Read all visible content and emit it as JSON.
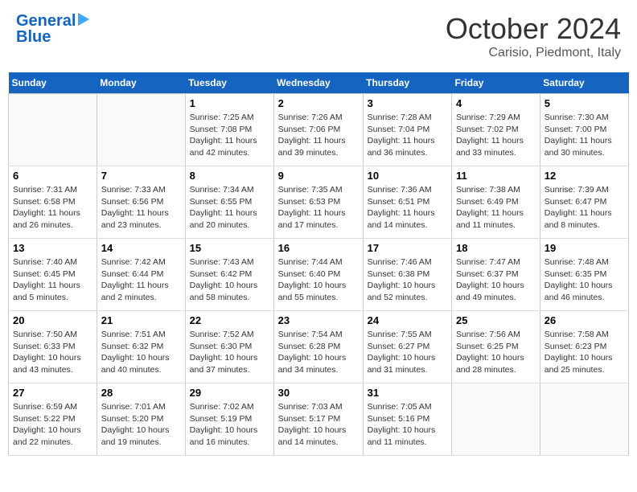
{
  "header": {
    "logo_line1": "General",
    "logo_line2": "Blue",
    "month": "October 2024",
    "location": "Carisio, Piedmont, Italy"
  },
  "days_of_week": [
    "Sunday",
    "Monday",
    "Tuesday",
    "Wednesday",
    "Thursday",
    "Friday",
    "Saturday"
  ],
  "weeks": [
    [
      {
        "num": "",
        "info": ""
      },
      {
        "num": "",
        "info": ""
      },
      {
        "num": "1",
        "info": "Sunrise: 7:25 AM\nSunset: 7:08 PM\nDaylight: 11 hours and 42 minutes."
      },
      {
        "num": "2",
        "info": "Sunrise: 7:26 AM\nSunset: 7:06 PM\nDaylight: 11 hours and 39 minutes."
      },
      {
        "num": "3",
        "info": "Sunrise: 7:28 AM\nSunset: 7:04 PM\nDaylight: 11 hours and 36 minutes."
      },
      {
        "num": "4",
        "info": "Sunrise: 7:29 AM\nSunset: 7:02 PM\nDaylight: 11 hours and 33 minutes."
      },
      {
        "num": "5",
        "info": "Sunrise: 7:30 AM\nSunset: 7:00 PM\nDaylight: 11 hours and 30 minutes."
      }
    ],
    [
      {
        "num": "6",
        "info": "Sunrise: 7:31 AM\nSunset: 6:58 PM\nDaylight: 11 hours and 26 minutes."
      },
      {
        "num": "7",
        "info": "Sunrise: 7:33 AM\nSunset: 6:56 PM\nDaylight: 11 hours and 23 minutes."
      },
      {
        "num": "8",
        "info": "Sunrise: 7:34 AM\nSunset: 6:55 PM\nDaylight: 11 hours and 20 minutes."
      },
      {
        "num": "9",
        "info": "Sunrise: 7:35 AM\nSunset: 6:53 PM\nDaylight: 11 hours and 17 minutes."
      },
      {
        "num": "10",
        "info": "Sunrise: 7:36 AM\nSunset: 6:51 PM\nDaylight: 11 hours and 14 minutes."
      },
      {
        "num": "11",
        "info": "Sunrise: 7:38 AM\nSunset: 6:49 PM\nDaylight: 11 hours and 11 minutes."
      },
      {
        "num": "12",
        "info": "Sunrise: 7:39 AM\nSunset: 6:47 PM\nDaylight: 11 hours and 8 minutes."
      }
    ],
    [
      {
        "num": "13",
        "info": "Sunrise: 7:40 AM\nSunset: 6:45 PM\nDaylight: 11 hours and 5 minutes."
      },
      {
        "num": "14",
        "info": "Sunrise: 7:42 AM\nSunset: 6:44 PM\nDaylight: 11 hours and 2 minutes."
      },
      {
        "num": "15",
        "info": "Sunrise: 7:43 AM\nSunset: 6:42 PM\nDaylight: 10 hours and 58 minutes."
      },
      {
        "num": "16",
        "info": "Sunrise: 7:44 AM\nSunset: 6:40 PM\nDaylight: 10 hours and 55 minutes."
      },
      {
        "num": "17",
        "info": "Sunrise: 7:46 AM\nSunset: 6:38 PM\nDaylight: 10 hours and 52 minutes."
      },
      {
        "num": "18",
        "info": "Sunrise: 7:47 AM\nSunset: 6:37 PM\nDaylight: 10 hours and 49 minutes."
      },
      {
        "num": "19",
        "info": "Sunrise: 7:48 AM\nSunset: 6:35 PM\nDaylight: 10 hours and 46 minutes."
      }
    ],
    [
      {
        "num": "20",
        "info": "Sunrise: 7:50 AM\nSunset: 6:33 PM\nDaylight: 10 hours and 43 minutes."
      },
      {
        "num": "21",
        "info": "Sunrise: 7:51 AM\nSunset: 6:32 PM\nDaylight: 10 hours and 40 minutes."
      },
      {
        "num": "22",
        "info": "Sunrise: 7:52 AM\nSunset: 6:30 PM\nDaylight: 10 hours and 37 minutes."
      },
      {
        "num": "23",
        "info": "Sunrise: 7:54 AM\nSunset: 6:28 PM\nDaylight: 10 hours and 34 minutes."
      },
      {
        "num": "24",
        "info": "Sunrise: 7:55 AM\nSunset: 6:27 PM\nDaylight: 10 hours and 31 minutes."
      },
      {
        "num": "25",
        "info": "Sunrise: 7:56 AM\nSunset: 6:25 PM\nDaylight: 10 hours and 28 minutes."
      },
      {
        "num": "26",
        "info": "Sunrise: 7:58 AM\nSunset: 6:23 PM\nDaylight: 10 hours and 25 minutes."
      }
    ],
    [
      {
        "num": "27",
        "info": "Sunrise: 6:59 AM\nSunset: 5:22 PM\nDaylight: 10 hours and 22 minutes."
      },
      {
        "num": "28",
        "info": "Sunrise: 7:01 AM\nSunset: 5:20 PM\nDaylight: 10 hours and 19 minutes."
      },
      {
        "num": "29",
        "info": "Sunrise: 7:02 AM\nSunset: 5:19 PM\nDaylight: 10 hours and 16 minutes."
      },
      {
        "num": "30",
        "info": "Sunrise: 7:03 AM\nSunset: 5:17 PM\nDaylight: 10 hours and 14 minutes."
      },
      {
        "num": "31",
        "info": "Sunrise: 7:05 AM\nSunset: 5:16 PM\nDaylight: 10 hours and 11 minutes."
      },
      {
        "num": "",
        "info": ""
      },
      {
        "num": "",
        "info": ""
      }
    ]
  ]
}
